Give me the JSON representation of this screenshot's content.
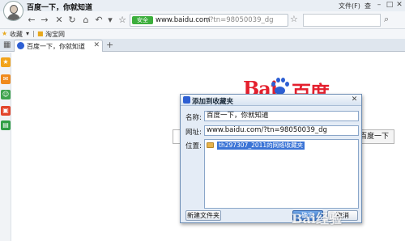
{
  "window": {
    "title": "百度一下，你就知道",
    "menu_file": "文件(F)",
    "menu_view": "查"
  },
  "nav": {
    "safe_badge": "安全",
    "url_host": "www.baidu.com",
    "url_path": "/?tn=98050039_dg"
  },
  "favbar": {
    "favorites_label": "收藏",
    "taobao_label": "淘宝网"
  },
  "tabs": [
    {
      "label": "百度一下，你就知道"
    }
  ],
  "page": {
    "logo_text": "Bai",
    "logo_text_2": "百度",
    "search_button": "百度一下"
  },
  "dialog": {
    "title": "添加到收藏夹",
    "name_label": "名称:",
    "name_value": "百度一下，你就知道",
    "url_label": "网址:",
    "url_value": "www.baidu.com/?tn=98050039_dg",
    "location_label": "位置:",
    "folder_name": "th297307_2011的网络收藏夹",
    "new_folder_button": "新建文件夹",
    "confirm_button": "确定",
    "cancel_button": "取消"
  },
  "watermark": "Bai经验",
  "colors": {
    "accent_blue": "#3b74d6",
    "baidu_red": "#e4202e",
    "safe_green": "#3cae3c"
  }
}
